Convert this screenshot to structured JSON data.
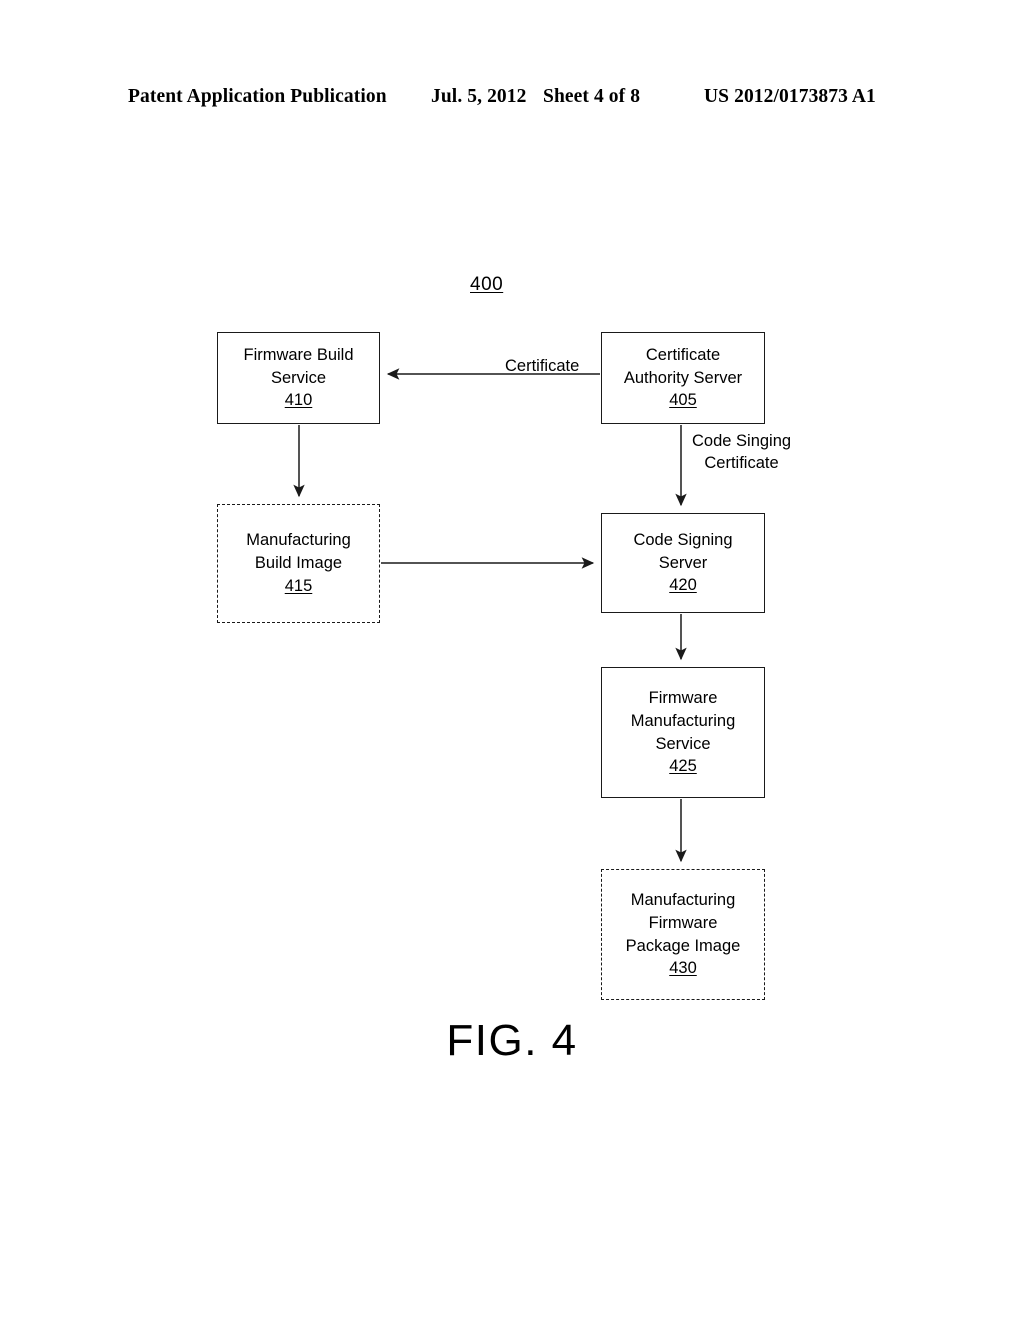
{
  "header": {
    "publication": "Patent Application Publication",
    "date": "Jul. 5, 2012",
    "sheet": "Sheet 4 of 8",
    "number": "US 2012/0173873 A1"
  },
  "figure": {
    "reference_numeral": "400",
    "caption": "FIG. 4",
    "nodes": [
      {
        "id": "410",
        "style": "solid",
        "lines": [
          "Firmware Build",
          "Service"
        ],
        "ref": "410"
      },
      {
        "id": "405",
        "style": "solid",
        "lines": [
          "Certificate",
          "Authority Server"
        ],
        "ref": "405"
      },
      {
        "id": "415",
        "style": "dashed",
        "lines": [
          "Manufacturing",
          "Build Image"
        ],
        "ref": "415"
      },
      {
        "id": "420",
        "style": "solid",
        "lines": [
          "Code Signing",
          "Server"
        ],
        "ref": "420"
      },
      {
        "id": "425",
        "style": "solid",
        "lines": [
          "Firmware",
          "Manufacturing",
          "Service"
        ],
        "ref": "425"
      },
      {
        "id": "430",
        "style": "dashed",
        "lines": [
          "Manufacturing",
          "Firmware",
          "Package Image"
        ],
        "ref": "430"
      }
    ],
    "edges": [
      {
        "from": "405",
        "to": "410",
        "label": "Certificate"
      },
      {
        "from": "405",
        "to": "420",
        "label_line1": "Code Singing",
        "label_line2": "Certificate"
      },
      {
        "from": "410",
        "to": "415",
        "label": ""
      },
      {
        "from": "415",
        "to": "420",
        "label": ""
      },
      {
        "from": "420",
        "to": "425",
        "label": ""
      },
      {
        "from": "425",
        "to": "430",
        "label": ""
      }
    ]
  },
  "colors": {
    "ink": "#1a1a1a",
    "background": "#ffffff"
  }
}
